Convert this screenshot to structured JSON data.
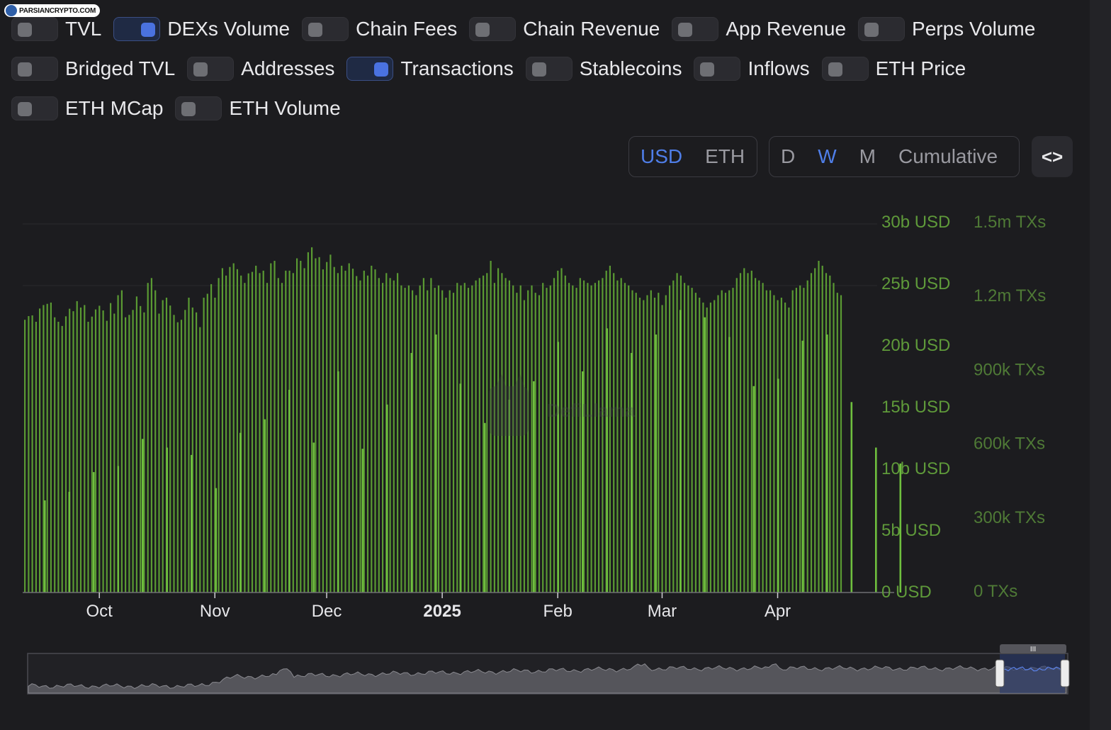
{
  "watermark": {
    "text": "PARSIANCRYPTO.COM"
  },
  "toggles": {
    "rows": [
      [
        {
          "label": "TVL",
          "on": false
        },
        {
          "label": "DEXs Volume",
          "on": true
        },
        {
          "label": "Chain Fees",
          "on": false
        },
        {
          "label": "Chain Revenue",
          "on": false
        },
        {
          "label": "App Revenue",
          "on": false
        },
        {
          "label": "Perps Volume",
          "on": false
        }
      ],
      [
        {
          "label": "Bridged TVL",
          "on": false
        },
        {
          "label": "Addresses",
          "on": false
        },
        {
          "label": "Transactions",
          "on": true
        },
        {
          "label": "Stablecoins",
          "on": false
        },
        {
          "label": "Inflows",
          "on": false
        },
        {
          "label": "ETH Price",
          "on": false
        }
      ],
      [
        {
          "label": "ETH MCap",
          "on": false
        },
        {
          "label": "ETH Volume",
          "on": false
        }
      ]
    ]
  },
  "denomination": {
    "options": [
      "USD",
      "ETH"
    ],
    "selected": "USD"
  },
  "period": {
    "options": [
      "D",
      "W",
      "M",
      "Cumulative"
    ],
    "selected": "W"
  },
  "embed_icon": "code-brackets-icon",
  "colors": {
    "accent": "#4f7ee8",
    "bar": "#5a9a33",
    "axis_label": "#5f9a3a",
    "brush_selection": "#2a3b6e"
  },
  "chart_data": {
    "type": "bar",
    "watermark_text": "DefiLlama",
    "x_ticks": [
      "Oct",
      "Nov",
      "Dec",
      "2025",
      "Feb",
      "Mar",
      "Apr"
    ],
    "x_tick_days": [
      20,
      51,
      81,
      112,
      143,
      171,
      202
    ],
    "y_left_ticks": [
      "30b USD",
      "25b USD",
      "20b USD",
      "15b USD",
      "10b USD",
      "5b USD",
      "0 USD"
    ],
    "y_right_ticks": [
      "1.5m TXs",
      "1.2m TXs",
      "900k TXs",
      "600k TXs",
      "300k TXs",
      "0 TXs"
    ],
    "y_left_range": [
      0,
      30
    ],
    "y_right_range": [
      0,
      1500000
    ],
    "series": [
      {
        "name": "Transactions",
        "unit": "TXs",
        "start": "2024-09-11",
        "values": [
          1110,
          1125,
          1128,
          1102,
          1156,
          1170,
          1175,
          1180,
          1120,
          1102,
          1085,
          1124,
          1155,
          1145,
          1186,
          1160,
          1170,
          1102,
          1123,
          1152,
          1167,
          1148,
          1106,
          1178,
          1135,
          1210,
          1230,
          1120,
          1130,
          1150,
          1205,
          1166,
          1140,
          1260,
          1280,
          1230,
          1135,
          1190,
          1200,
          1168,
          1130,
          1100,
          1110,
          1150,
          1200,
          1160,
          1140,
          1080,
          1200,
          1216,
          1255,
          1200,
          1280,
          1320,
          1290,
          1325,
          1340,
          1316,
          1290,
          1260,
          1299,
          1305,
          1330,
          1300,
          1310,
          1260,
          1340,
          1350,
          1280,
          1260,
          1310,
          1310,
          1300,
          1360,
          1350,
          1320,
          1385,
          1405,
          1360,
          1365,
          1315,
          1345,
          1375,
          1325,
          1300,
          1330,
          1310,
          1340,
          1318,
          1288,
          1270,
          1310,
          1290,
          1330,
          1315,
          1280,
          1260,
          1300,
          1280,
          1270,
          1300,
          1250,
          1240,
          1250,
          1230,
          1210,
          1250,
          1280,
          1230,
          1280,
          1240,
          1250,
          1230,
          1200,
          1230,
          1220,
          1260,
          1250,
          1260,
          1240,
          1250,
          1270,
          1280,
          1290,
          1300,
          1350,
          1260,
          1320,
          1300,
          1280,
          1270,
          1250,
          1220,
          1250,
          1190,
          1230,
          1250,
          1220,
          1210,
          1260,
          1240,
          1250,
          1280,
          1310,
          1320,
          1290,
          1260,
          1250,
          1240,
          1280,
          1270,
          1260,
          1250,
          1260,
          1270,
          1280,
          1310,
          1330,
          1300,
          1270,
          1280,
          1260,
          1250,
          1230,
          1220,
          1200,
          1190,
          1210,
          1230,
          1200,
          1220,
          1170,
          1210,
          1250,
          1270,
          1300,
          1290,
          1260,
          1250,
          1240,
          1220,
          1200,
          1180,
          1160,
          1180,
          1190,
          1210,
          1230,
          1220,
          1230,
          1240,
          1280,
          1300,
          1320,
          1300,
          1310,
          1280,
          1270,
          1260,
          1230,
          1230,
          1210,
          1190,
          1200,
          1180,
          1160,
          1230,
          1240,
          1250,
          1240,
          1270,
          1300,
          1320,
          1350,
          1330,
          1300,
          1290,
          1260,
          1220,
          1210
        ]
      },
      {
        "name": "DEXs Volume",
        "unit": "USD",
        "values_usd_billions": [
          7.5,
          8.2,
          9.8,
          10.3,
          12.5,
          11.8,
          11.2,
          8.5,
          13.0,
          14.1,
          16.5,
          12.2,
          18.0,
          11.7,
          15.3,
          19.5,
          21.0,
          17.0,
          13.8,
          15.7,
          17.2,
          20.4,
          18.0,
          21.5,
          19.5,
          21.0,
          23.0,
          22.4,
          20.8,
          16.8,
          17.4,
          20.5,
          21.0,
          15.5,
          11.8,
          10.5
        ]
      }
    ]
  }
}
